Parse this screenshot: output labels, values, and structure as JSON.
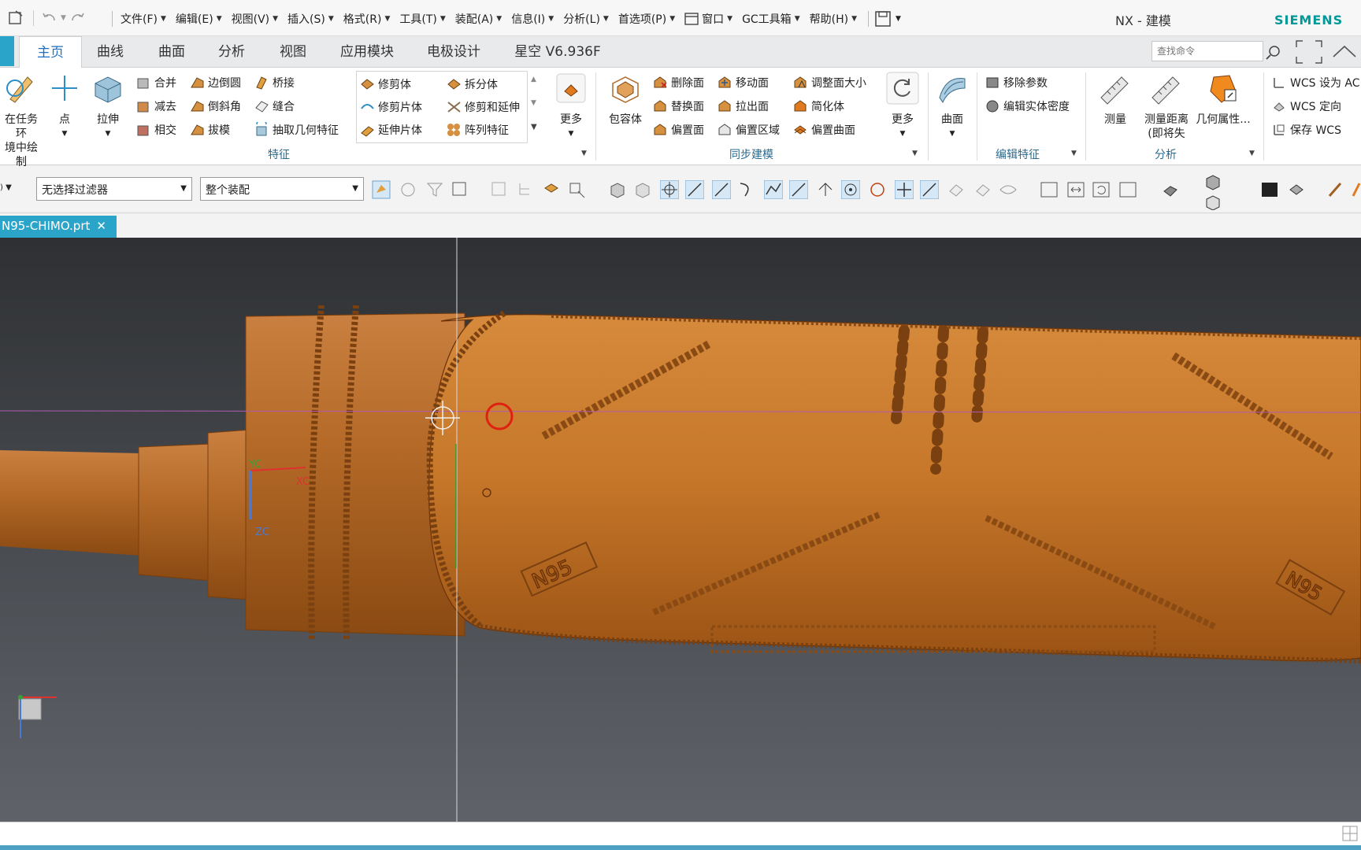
{
  "window": {
    "app_title": "NX - 建模",
    "brand": "SIEMENS"
  },
  "menu": {
    "items": [
      "文件(F)",
      "编辑(E)",
      "视图(V)",
      "插入(S)",
      "格式(R)",
      "工具(T)",
      "装配(A)",
      "信息(I)",
      "分析(L)",
      "首选项(P)",
      "窗口",
      "GC工具箱",
      "帮助(H)"
    ]
  },
  "tabs": {
    "items": [
      "主页",
      "曲线",
      "曲面",
      "分析",
      "视图",
      "应用模块",
      "电极设计",
      "星空 V6.936F"
    ],
    "active": "主页",
    "search_placeholder": "查找命令"
  },
  "ribbon": {
    "sketch": {
      "line1": "在任务环",
      "line2": "境中绘制"
    },
    "point": "点",
    "extrude": "拉伸",
    "feature_col1": [
      "合并",
      "减去",
      "相交"
    ],
    "feature_col2": [
      "边倒圆",
      "倒斜角",
      "拔模"
    ],
    "feature_col3": [
      "桥接",
      "缝合",
      "抽取几何特征"
    ],
    "feature_gallery_col1": [
      "修剪体",
      "修剪片体",
      "延伸片体"
    ],
    "feature_gallery_col2": [
      "拆分体",
      "修剪和延伸",
      "阵列特征"
    ],
    "more": "更多",
    "group_feature": "特征",
    "wrap": "包容体",
    "sync_col1": [
      "删除面",
      "替换面",
      "偏置面"
    ],
    "sync_col2": [
      "移动面",
      "拉出面",
      "偏置区域"
    ],
    "sync_col3": [
      "调整面大小",
      "简化体",
      "偏置曲面"
    ],
    "more2": "更多",
    "group_sync": "同步建模",
    "surface": "曲面",
    "edit_items": [
      "移除参数",
      "编辑实体密度"
    ],
    "group_edit": "编辑特征",
    "measure": "测量",
    "measure_dist": {
      "line1": "测量距离",
      "line2": "(即将失"
    },
    "geom_props": "几何属性...",
    "group_analysis": "分析",
    "wcs_items": [
      "WCS 设为 AC",
      "WCS 定向",
      "保存 WCS"
    ]
  },
  "selection": {
    "filter_value": "无选择过滤器",
    "scope_value": "整个装配"
  },
  "document": {
    "tab_label": "N95-CHIMO.prt"
  },
  "viewport": {
    "part_color": "#c7782a",
    "axis_labels": {
      "yc": "YC",
      "xc": "XC",
      "zc": "ZC"
    },
    "emboss_text": "N95"
  }
}
